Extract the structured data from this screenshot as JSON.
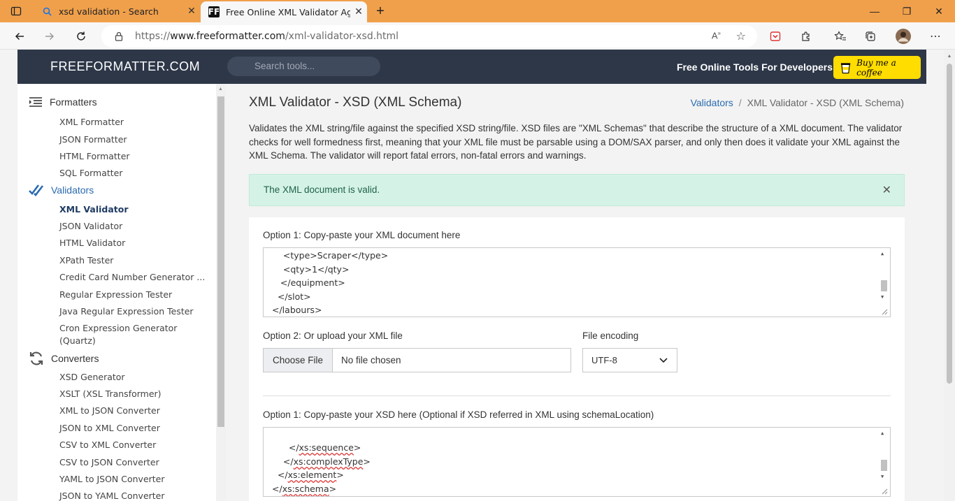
{
  "browser": {
    "tabs": [
      {
        "title": "xsd validation - Search",
        "active": false
      },
      {
        "title": "Free Online XML Validator Again",
        "active": true
      }
    ],
    "new_tab": "+",
    "url": {
      "scheme": "https://",
      "host": "www.freeformatter.com",
      "path": "/xml-validator-xsd.html"
    },
    "window_controls": {
      "minimize": "—",
      "restore": "❐",
      "close": "✕"
    }
  },
  "site": {
    "brand": "FREEFORMATTER.COM",
    "search_placeholder": "Search tools...",
    "tagline": "Free Online Tools For Developers",
    "coffee_label": "Buy me a coffee"
  },
  "sidebar": {
    "sections": [
      {
        "label": "Formatters",
        "items": [
          "XML Formatter",
          "JSON Formatter",
          "HTML Formatter",
          "SQL Formatter"
        ]
      },
      {
        "label": "Validators",
        "items": [
          "XML Validator",
          "JSON Validator",
          "HTML Validator",
          "XPath Tester",
          "Credit Card Number Generator ...",
          "Regular Expression Tester",
          "Java Regular Expression Tester",
          "Cron Expression Generator",
          "(Quartz)"
        ]
      },
      {
        "label": "Converters",
        "items": [
          "XSD Generator",
          "XSLT (XSL Transformer)",
          "XML to JSON Converter",
          "JSON to XML Converter",
          "CSV to XML Converter",
          "CSV to JSON Converter",
          "YAML to JSON Converter",
          "JSON to YAML Converter"
        ]
      }
    ]
  },
  "main": {
    "title": "XML Validator - XSD (XML Schema)",
    "breadcrumb": {
      "parent": "Validators",
      "separator": "/",
      "current": "XML Validator - XSD (XML Schema)"
    },
    "description": "Validates the XML string/file against the specified XSD string/file. XSD files are \"XML Schemas\" that describe the structure of a XML document. The validator checks for well formedness first, meaning that your XML file must be parsable using a DOM/SAX parser, and only then does it validate your XML against the XML Schema. The validator will report fatal errors, non-fatal errors and warnings.",
    "alert": {
      "message": "The XML document is valid.",
      "close": "✕"
    },
    "xml_input": {
      "label": "Option 1: Copy-paste your XML document here",
      "lines": [
        "    <type>Scraper</type>",
        "    <qty>1</qty>",
        "   </equipment>",
        "  </slot>",
        "</labours>"
      ]
    },
    "upload": {
      "label": "Option 2: Or upload your XML file",
      "button": "Choose File",
      "status": "No file chosen"
    },
    "encoding": {
      "label": "File encoding",
      "value": "UTF-8"
    },
    "xsd_input": {
      "label": "Option 1: Copy-paste your XSD here (Optional if XSD referred in XML using schemaLocation)",
      "lines": [
        {
          "indent": "      ",
          "open": "</",
          "tag": "xs:sequence",
          "close": ">"
        },
        {
          "indent": "    ",
          "open": "</",
          "tag": "xs:complexType",
          "close": ">"
        },
        {
          "indent": "  ",
          "open": "</",
          "tag": "xs:element",
          "close": ">"
        },
        {
          "indent": "",
          "open": "</",
          "tag": "xs:schema",
          "close": ">"
        }
      ]
    }
  }
}
